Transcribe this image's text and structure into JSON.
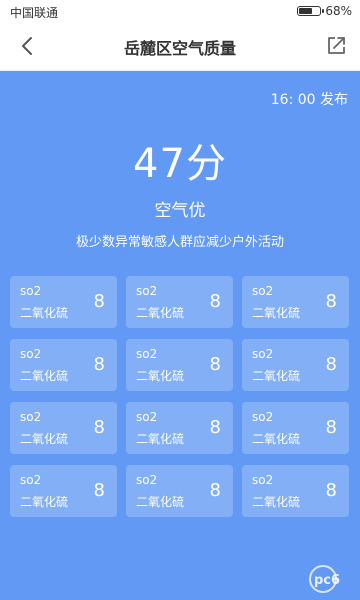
{
  "status_bar": {
    "carrier": "中国联通",
    "battery": "68%",
    "battery_level": 0.68
  },
  "nav": {
    "title": "岳麓区空气质量",
    "back_icon": "chevron-left-icon",
    "share_icon": "share-icon"
  },
  "summary": {
    "publish_time": "16: 00 发布",
    "score": "47分",
    "level": "空气优",
    "advice": "极少数异常敏感人群应减少户外活动"
  },
  "pollutants": [
    {
      "code": "so2",
      "name": "二氧化硫",
      "value": "8"
    },
    {
      "code": "so2",
      "name": "二氧化硫",
      "value": "8"
    },
    {
      "code": "so2",
      "name": "二氧化硫",
      "value": "8"
    },
    {
      "code": "so2",
      "name": "二氧化硫",
      "value": "8"
    },
    {
      "code": "so2",
      "name": "二氧化硫",
      "value": "8"
    },
    {
      "code": "so2",
      "name": "二氧化硫",
      "value": "8"
    },
    {
      "code": "so2",
      "name": "二氧化硫",
      "value": "8"
    },
    {
      "code": "so2",
      "name": "二氧化硫",
      "value": "8"
    },
    {
      "code": "so2",
      "name": "二氧化硫",
      "value": "8"
    },
    {
      "code": "so2",
      "name": "二氧化硫",
      "value": "8"
    },
    {
      "code": "so2",
      "name": "二氧化硫",
      "value": "8"
    },
    {
      "code": "so2",
      "name": "二氧化硫",
      "value": "8"
    }
  ],
  "colors": {
    "accent": "#6199f5",
    "card": "rgba(255,255,255,0.22)"
  },
  "watermark": {
    "text": "pc6",
    "icon": "pc6-logo-icon"
  }
}
